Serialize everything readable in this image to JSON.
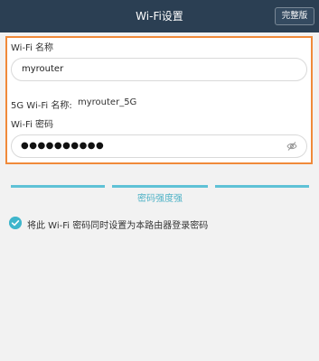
{
  "header": {
    "title": "Wi-Fi设置",
    "full_version_label": "完整版"
  },
  "form": {
    "wifi_name_label": "Wi-Fi 名称",
    "wifi_name_value": "myrouter",
    "wifi5g_label": "5G Wi-Fi 名称:",
    "wifi5g_value": "myrouter_5G",
    "password_label": "Wi-Fi 密码",
    "password_value": "●●●●●●●●●●"
  },
  "strength": {
    "label": "密码强度强",
    "level": "strong"
  },
  "option": {
    "checked": true,
    "label": "将此 Wi-Fi 密码同时设置为本路由器登录密码"
  },
  "colors": {
    "header_bg": "#2b3f53",
    "highlight_border": "#f08a3a",
    "accent": "#3fb6cc"
  },
  "icons": {
    "eye": "eye-slash-icon",
    "check": "check-circle-icon"
  }
}
